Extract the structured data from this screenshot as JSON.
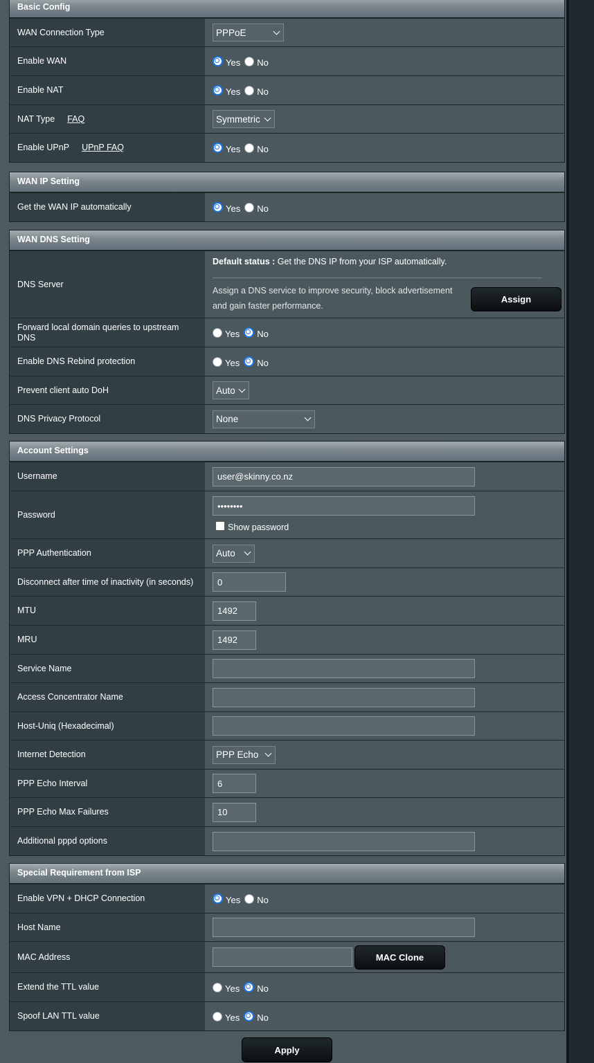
{
  "basic": {
    "title": "Basic Config",
    "wan_type_label": "WAN Connection Type",
    "wan_type_value": "PPPoE",
    "enable_wan_label": "Enable WAN",
    "enable_nat_label": "Enable NAT",
    "nat_type_label": "NAT Type",
    "nat_type_faq": "FAQ",
    "nat_type_value": "Symmetric",
    "upnp_label": "Enable UPnP",
    "upnp_faq": "UPnP FAQ"
  },
  "radio": {
    "yes": "Yes",
    "no": "No"
  },
  "wanip": {
    "title": "WAN IP Setting",
    "auto_label": "Get the WAN IP automatically"
  },
  "wandns": {
    "title": "WAN DNS Setting",
    "dns_server_label": "DNS Server",
    "default_status_bold": "Default status :",
    "default_status_text": " Get the DNS IP from your ISP automatically.",
    "assign_text": "Assign a DNS service to improve security, block advertisement and gain faster performance.",
    "assign_button": "Assign",
    "forward_label": "Forward local domain queries to upstream DNS",
    "rebind_label": "Enable DNS Rebind protection",
    "doh_label": "Prevent client auto DoH",
    "doh_value": "Auto",
    "privacy_label": "DNS Privacy Protocol",
    "privacy_value": "None"
  },
  "account": {
    "title": "Account Settings",
    "username_label": "Username",
    "username_value": "user@skinny.co.nz",
    "password_label": "Password",
    "password_value": "••••••••",
    "show_password": "Show password",
    "ppp_auth_label": "PPP Authentication",
    "ppp_auth_value": "Auto",
    "idle_label": "Disconnect after time of inactivity (in seconds)",
    "idle_value": "0",
    "mtu_label": "MTU",
    "mtu_value": "1492",
    "mru_label": "MRU",
    "mru_value": "1492",
    "service_label": "Service Name",
    "service_value": "",
    "ac_label": "Access Concentrator Name",
    "ac_value": "",
    "hostuniq_label": "Host-Uniq (Hexadecimal)",
    "hostuniq_value": "",
    "detect_label": "Internet Detection",
    "detect_value": "PPP Echo",
    "echo_interval_label": "PPP Echo Interval",
    "echo_interval_value": "6",
    "echo_fail_label": "PPP Echo Max Failures",
    "echo_fail_value": "10",
    "pppd_label": "Additional pppd options",
    "pppd_value": ""
  },
  "special": {
    "title": "Special Requirement from ISP",
    "vpn_label": "Enable VPN + DHCP Connection",
    "host_label": "Host Name",
    "host_value": "",
    "mac_label": "MAC Address",
    "mac_value": "",
    "mac_clone_button": "MAC Clone",
    "ttl_label": "Extend the TTL value",
    "spoof_label": "Spoof LAN TTL value"
  },
  "apply_button": "Apply"
}
